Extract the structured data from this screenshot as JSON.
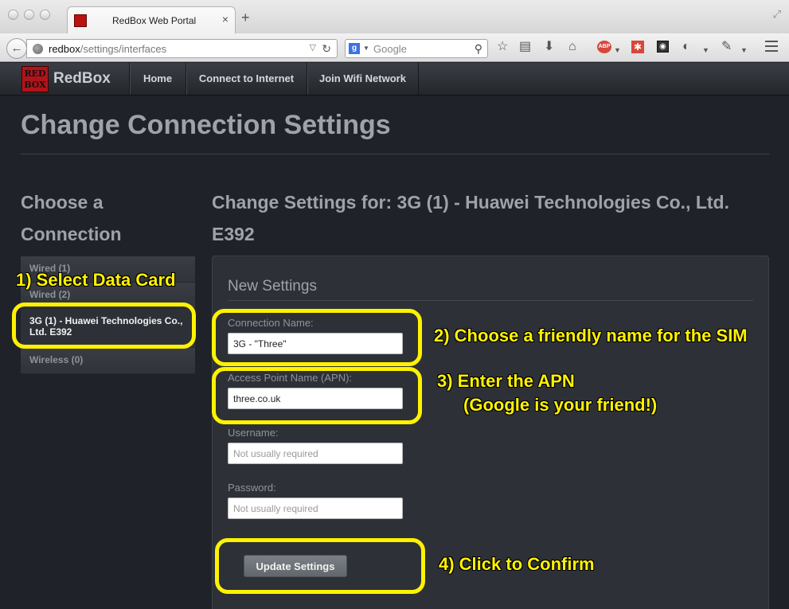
{
  "browser": {
    "tab_title": "RedBox Web Portal",
    "url_host": "redbox",
    "url_path": "/settings/interfaces",
    "search_placeholder": "Google"
  },
  "app": {
    "brand": "RedBox",
    "logo_text": "RED BOX",
    "nav": [
      "Home",
      "Connect to Internet",
      "Join Wifi Network"
    ]
  },
  "page": {
    "title": "Change Connection Settings",
    "sidebar_heading": "Choose a Connection",
    "main_heading": "Change Settings for: 3G (1) - Huawei Technologies Co., Ltd. E392"
  },
  "connections": [
    {
      "label": "Wired (1)",
      "active": false
    },
    {
      "label": "Wired (2)",
      "active": false
    },
    {
      "label": "3G (1) - Huawei Technologies Co., Ltd. E392",
      "active": true
    },
    {
      "label": "Wireless (0)",
      "active": false
    }
  ],
  "form": {
    "title": "New Settings",
    "connection_name_label": "Connection Name:",
    "connection_name_value": "3G - \"Three\"",
    "apn_label": "Access Point Name (APN):",
    "apn_value": "three.co.uk",
    "username_label": "Username:",
    "username_placeholder": "Not usually required",
    "password_label": "Password:",
    "password_placeholder": "Not usually required",
    "submit_label": "Update Settings"
  },
  "annotations": {
    "step1": "1) Select Data Card",
    "step2": "2) Choose a friendly name for the SIM",
    "step3_line1": "3) Enter the APN",
    "step3_line2": "(Google is your friend!)",
    "step4": "4) Click to Confirm"
  },
  "colors": {
    "annotation": "#fff200",
    "page_background": "#1f2329",
    "logo_red": "#b0141a"
  }
}
